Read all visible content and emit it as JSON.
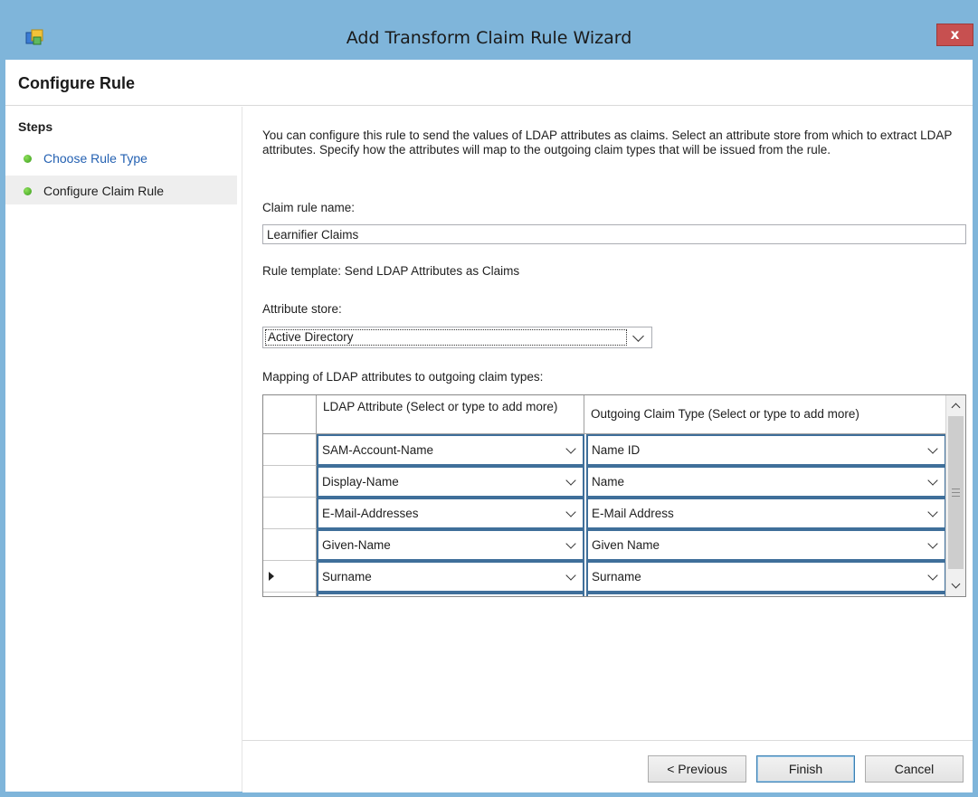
{
  "window": {
    "title": "Add Transform Claim Rule Wizard",
    "close_glyph": "x",
    "app_icon": "claim-rule-wizard-icon",
    "accent_color": "#7fb5da"
  },
  "header": {
    "title": "Configure Rule"
  },
  "sidebar": {
    "title": "Steps",
    "items": [
      {
        "label": "Choose Rule Type",
        "state": "link"
      },
      {
        "label": "Configure Claim Rule",
        "state": "active"
      }
    ]
  },
  "main": {
    "intro": "You can configure this rule to send the values of LDAP attributes as claims. Select an attribute store from which to extract LDAP attributes. Specify how the attributes will map to the outgoing claim types that will be issued from the rule.",
    "claim_rule_name_label": "Claim rule name:",
    "claim_rule_name_value": "Learnifier Claims",
    "rule_template_text": "Rule template: Send LDAP Attributes as Claims",
    "attribute_store_label": "Attribute store:",
    "attribute_store_value": "Active Directory",
    "mapping_label": "Mapping of LDAP attributes to outgoing claim types:",
    "mapping_table": {
      "columns": [
        "LDAP Attribute (Select or type to add more)",
        "Outgoing Claim Type (Select or type to add more)"
      ],
      "rows": [
        {
          "ldap": "SAM-Account-Name",
          "claim": "Name ID"
        },
        {
          "ldap": "Display-Name",
          "claim": "Name"
        },
        {
          "ldap": "E-Mail-Addresses",
          "claim": "E-Mail Address"
        },
        {
          "ldap": "Given-Name",
          "claim": "Given Name"
        },
        {
          "ldap": "Surname",
          "claim": "Surname"
        },
        {
          "ldap": "",
          "claim": ""
        }
      ],
      "current_row_index": 4
    }
  },
  "footer": {
    "previous_label": "< Previous",
    "finish_label": "Finish",
    "cancel_label": "Cancel"
  }
}
